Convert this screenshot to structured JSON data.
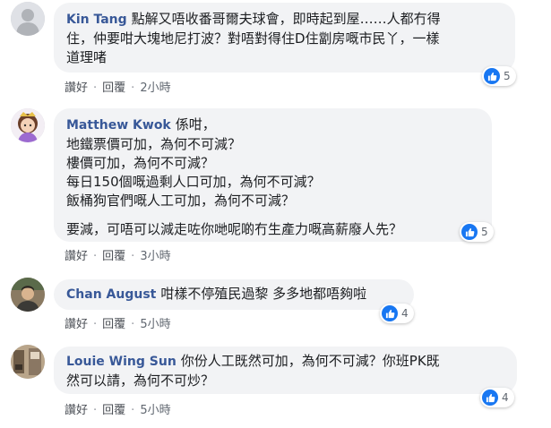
{
  "comments": [
    {
      "author": "Kin Tang",
      "lines": [
        "點解又唔收番哥爾夫球會，即時起到屋……人都冇得",
        "住，仲要咁大塊地尼打波？對唔對得住D住劏房嘅市民丫，一樣",
        "道理啫"
      ],
      "actions": {
        "like": "讚好",
        "reply": "回覆",
        "time": "2小時"
      },
      "reactions": "5",
      "avatar": "default"
    },
    {
      "author": "Matthew Kwok",
      "lines": [
        "係咁，",
        "地鐵票價可加，為何不可減？",
        "樓價可加，為何不可減？",
        "每日150個嘅過剩人口可加，為何不可減？",
        "飯桶狗官們嘅人工可加，為何不可減？",
        "",
        "要減，可唔可以減走咗你哋呢啲冇生產力嘅高薪廢人先？"
      ],
      "actions": {
        "like": "讚好",
        "reply": "回覆",
        "time": "3小時"
      },
      "reactions": "5",
      "avatar": "cartoon"
    },
    {
      "author": "Chan August",
      "lines": [
        "咁樣不停殖民過黎 多多地都唔夠啦"
      ],
      "actions": {
        "like": "讚好",
        "reply": "回覆",
        "time": "5小時"
      },
      "reactions": "4",
      "avatar": "photo"
    },
    {
      "author": "Louie Wing Sun",
      "lines": [
        "你份人工既然可加，為何不可減？你班PK既",
        "然可以請，為何不可炒？"
      ],
      "actions": {
        "like": "讚好",
        "reply": "回覆",
        "time": "5小時"
      },
      "reactions": "4",
      "avatar": "photo2"
    }
  ],
  "colors": {
    "author": "#385898",
    "bubble": "#f2f3f5",
    "like": "#1877f2",
    "meta": "#606770"
  },
  "icons": {
    "like": "thumbs-up-icon",
    "default_avatar": "person-silhouette-icon"
  }
}
